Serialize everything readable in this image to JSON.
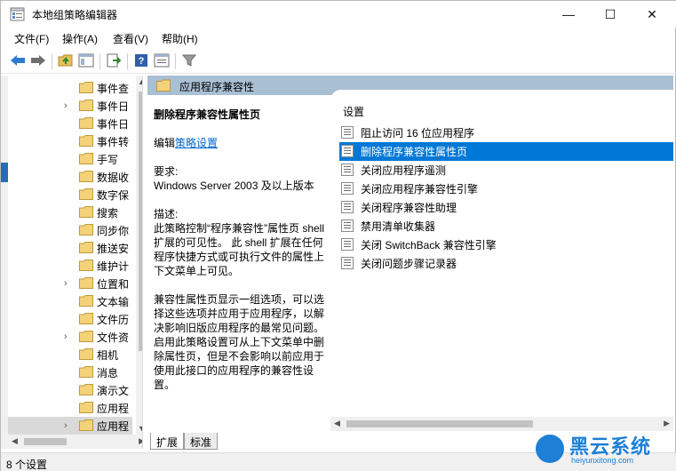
{
  "window": {
    "title": "本地组策略编辑器",
    "controls": {
      "minimize": "—",
      "maximize": "☐",
      "close": "✕"
    }
  },
  "menu": [
    {
      "label": "文件(F)"
    },
    {
      "label": "操作(A)"
    },
    {
      "label": "查看(V)"
    },
    {
      "label": "帮助(H)"
    }
  ],
  "toolbar": {
    "icons": [
      "back-arrow-icon",
      "forward-arrow-icon",
      "up-folder-icon",
      "show-hide-tree-icon",
      "export-list-icon",
      "help-icon",
      "properties-icon",
      "filter-icon"
    ]
  },
  "tree": {
    "items": [
      {
        "label": "事件查",
        "expandable": false
      },
      {
        "label": "事件日",
        "expandable": true
      },
      {
        "label": "事件日",
        "expandable": false
      },
      {
        "label": "事件转",
        "expandable": false
      },
      {
        "label": "手写",
        "expandable": false
      },
      {
        "label": "数据收",
        "expandable": false
      },
      {
        "label": "数字保",
        "expandable": false
      },
      {
        "label": "搜索",
        "expandable": false
      },
      {
        "label": "同步你",
        "expandable": false
      },
      {
        "label": "推送安",
        "expandable": false
      },
      {
        "label": "维护计",
        "expandable": false
      },
      {
        "label": "位置和",
        "expandable": true
      },
      {
        "label": "文本输",
        "expandable": false
      },
      {
        "label": "文件历",
        "expandable": false
      },
      {
        "label": "文件资",
        "expandable": true
      },
      {
        "label": "相机",
        "expandable": false
      },
      {
        "label": "消息",
        "expandable": false
      },
      {
        "label": "演示文",
        "expandable": false
      },
      {
        "label": "应用程",
        "expandable": false
      },
      {
        "label": "应用程",
        "expandable": true,
        "selected": true
      }
    ]
  },
  "right": {
    "header_title": "应用程序兼容性",
    "description": {
      "title": "删除程序兼容性属性页",
      "edit_prefix": "编辑",
      "edit_link": "策略设置",
      "requirements_label": "要求:",
      "requirements_value": "Windows Server 2003 及以上版本",
      "desc_label": "描述:",
      "desc_lines": [
        "此策略控制“程序兼容性”属性页 shell",
        "扩展的可见性。 此 shell 扩展在任何",
        "程序快捷方式或可执行文件的属性上",
        "下文菜单上可见。"
      ],
      "desc2_lines": [
        "兼容性属性页显示一组选项，可以选",
        "择这些选项并应用于应用程序，以解",
        "决影响旧版应用程序的最常见问题。",
        "启用此策略设置可从上下文菜单中删",
        "除属性页，但是不会影响以前应用于",
        "使用此接口的应用程序的兼容性设",
        "置。"
      ]
    },
    "list_header": "设置",
    "settings": [
      {
        "label": "阻止访问 16 位应用程序",
        "selected": false
      },
      {
        "label": "删除程序兼容性属性页",
        "selected": true
      },
      {
        "label": "关闭应用程序遥测",
        "selected": false
      },
      {
        "label": "关闭应用程序兼容性引擎",
        "selected": false
      },
      {
        "label": "关闭程序兼容性助理",
        "selected": false
      },
      {
        "label": "禁用清单收集器",
        "selected": false
      },
      {
        "label": "关闭 SwitchBack 兼容性引擎",
        "selected": false
      },
      {
        "label": "关闭问题步骤记录器",
        "selected": false
      }
    ]
  },
  "tabs": [
    {
      "label": "扩展",
      "active": true
    },
    {
      "label": "标准",
      "active": false
    }
  ],
  "status": {
    "text": "8 个设置"
  },
  "watermark": {
    "text": "黑云系统",
    "url": "heiyunxitong.com"
  },
  "colors": {
    "header_band": "#a9bfd4",
    "selection": "#0078d7",
    "link": "#0066cc",
    "watermark": "#1d7fd6"
  }
}
